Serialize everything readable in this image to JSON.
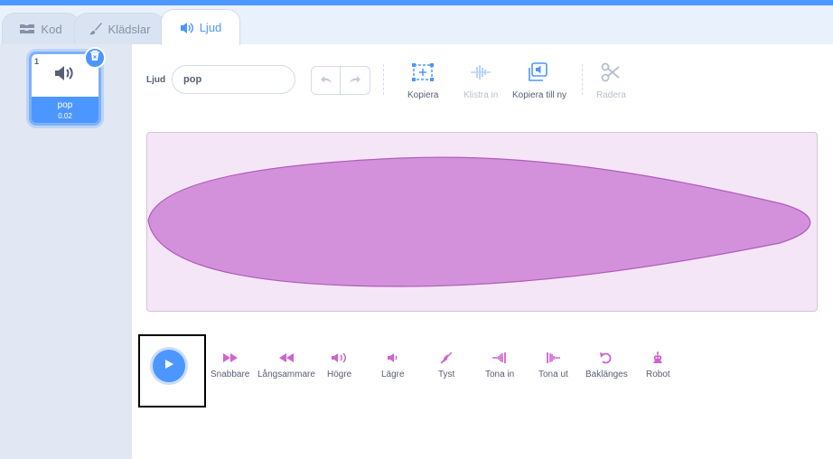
{
  "tabs": [
    {
      "label": "Kod",
      "icon": "code-blocks-icon"
    },
    {
      "label": "Klädslar",
      "icon": "paintbrush-icon"
    },
    {
      "label": "Ljud",
      "icon": "speaker-icon",
      "active": true
    }
  ],
  "sidebar": {
    "sound_tile": {
      "number": "1",
      "name": "pop",
      "duration": "0.02",
      "icon": "speaker-icon"
    },
    "delete_icon": "trash-icon"
  },
  "editor": {
    "name_label": "Ljud",
    "name_value": "pop",
    "tools": {
      "copy": "Kopiera",
      "paste": "Klistra in",
      "copy_to_new": "Kopiera till ny",
      "delete": "Radera"
    },
    "effects": [
      {
        "label": "Snabbare",
        "icon": "fast-forward-icon"
      },
      {
        "label": "Långsammare",
        "icon": "rewind-icon"
      },
      {
        "label": "Högre",
        "icon": "louder-icon"
      },
      {
        "label": "Lägre",
        "icon": "softer-icon"
      },
      {
        "label": "Tyst",
        "icon": "mute-icon"
      },
      {
        "label": "Tona in",
        "icon": "fade-in-icon"
      },
      {
        "label": "Tona ut",
        "icon": "fade-out-icon"
      },
      {
        "label": "Baklänges",
        "icon": "reverse-icon"
      },
      {
        "label": "Robot",
        "icon": "robot-icon"
      }
    ]
  },
  "colors": {
    "accent": "#4c97ff",
    "sound": "#cf63cf",
    "wave_fill": "#d391db",
    "wave_bg": "#f4e6f6"
  }
}
